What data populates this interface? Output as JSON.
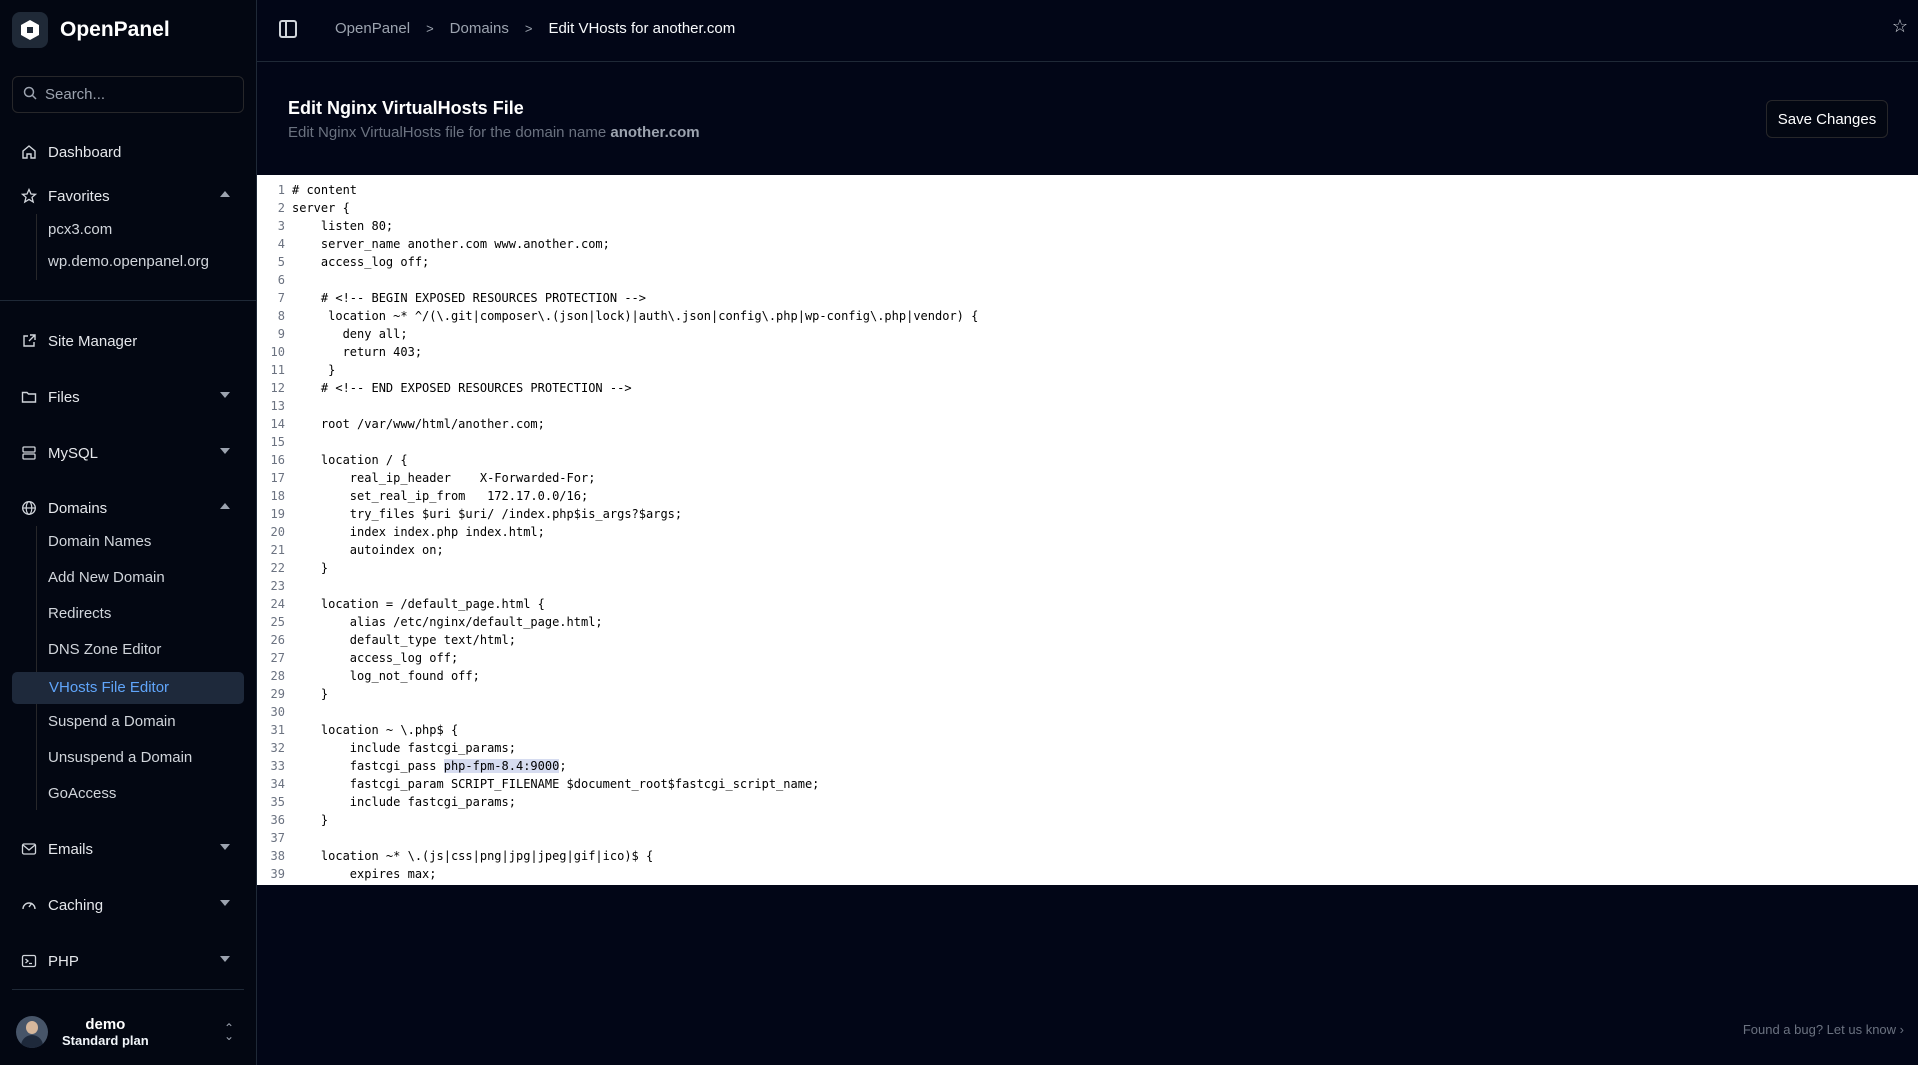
{
  "app": {
    "name": "OpenPanel"
  },
  "search": {
    "placeholder": "Search..."
  },
  "nav": {
    "dashboard": "Dashboard",
    "favorites": {
      "label": "Favorites",
      "items": [
        "pcx3.com",
        "wp.demo.openpanel.org"
      ]
    },
    "site_manager": "Site Manager",
    "files": "Files",
    "mysql": "MySQL",
    "domains": {
      "label": "Domains",
      "items": [
        "Domain Names",
        "Add New Domain",
        "Redirects",
        "DNS Zone Editor",
        "VHosts File Editor",
        "Suspend a Domain",
        "Unsuspend a Domain",
        "GoAccess"
      ],
      "active": "VHosts File Editor"
    },
    "emails": "Emails",
    "caching": "Caching",
    "php": "PHP"
  },
  "user": {
    "name": "demo",
    "plan": "Standard plan"
  },
  "breadcrumb": [
    "OpenPanel",
    "Domains",
    "Edit VHosts for another.com"
  ],
  "page": {
    "title": "Edit Nginx VirtualHosts File",
    "subtitle_prefix": "Edit Nginx VirtualHosts file for the domain name ",
    "domain": "another.com",
    "save_label": "Save Changes"
  },
  "editor": {
    "highlight": {
      "line": 33,
      "text": "php-fpm-8.4:9000"
    },
    "lines": [
      "# content",
      "server {",
      "    listen 80;",
      "    server_name another.com www.another.com;",
      "    access_log off;",
      "",
      "    # <!-- BEGIN EXPOSED RESOURCES PROTECTION -->",
      "     location ~* ^/(\\.git|composer\\.(json|lock)|auth\\.json|config\\.php|wp-config\\.php|vendor) {",
      "       deny all;",
      "       return 403;",
      "     }",
      "    # <!-- END EXPOSED RESOURCES PROTECTION -->",
      "",
      "    root /var/www/html/another.com;",
      "",
      "    location / {",
      "        real_ip_header    X-Forwarded-For;",
      "        set_real_ip_from   172.17.0.0/16;",
      "        try_files $uri $uri/ /index.php$is_args?$args;",
      "        index index.php index.html;",
      "        autoindex on;",
      "    }",
      "",
      "    location = /default_page.html {",
      "        alias /etc/nginx/default_page.html;",
      "        default_type text/html;",
      "        access_log off;",
      "        log_not_found off;",
      "    }",
      "",
      "    location ~ \\.php$ {",
      "        include fastcgi_params;",
      "        fastcgi_pass php-fpm-8.4:9000;",
      "        fastcgi_param SCRIPT_FILENAME $document_root$fastcgi_script_name;",
      "        include fastcgi_params;",
      "    }",
      "",
      "    location ~* \\.(js|css|png|jpg|jpeg|gif|ico)$ {",
      "        expires max;"
    ]
  },
  "footer": {
    "bug_text": "Found a bug? Let us know ›"
  }
}
